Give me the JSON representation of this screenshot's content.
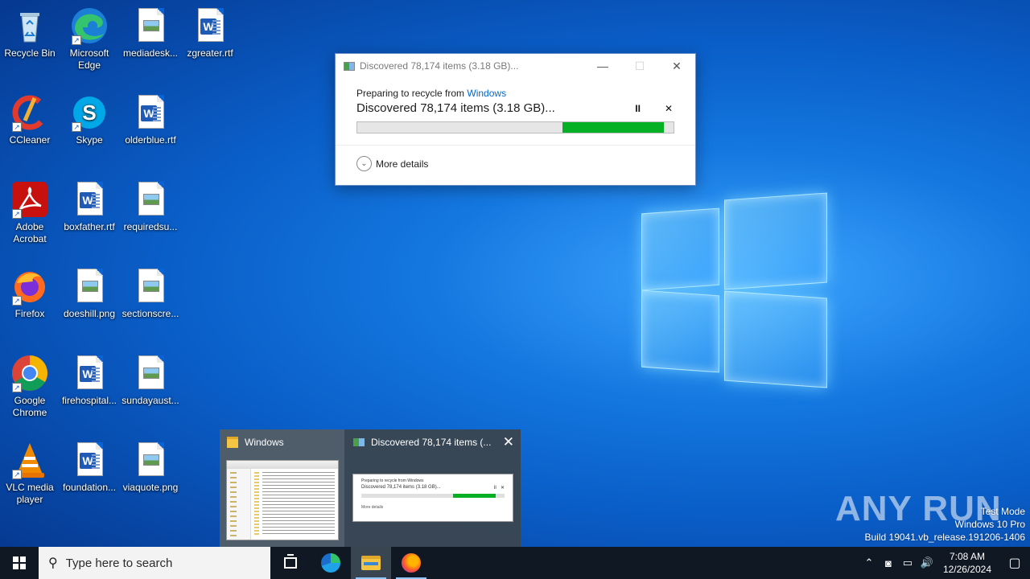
{
  "desktop": {
    "icons": [
      {
        "label": "Recycle Bin",
        "icon": "recycle-bin-icon"
      },
      {
        "label": "Microsoft Edge",
        "icon": "edge-icon"
      },
      {
        "label": "mediadesk...",
        "icon": "image-file-icon"
      },
      {
        "label": "zgreater.rtf",
        "icon": "word-document-icon"
      },
      {
        "label": "CCleaner",
        "icon": "ccleaner-icon"
      },
      {
        "label": "Skype",
        "icon": "skype-icon"
      },
      {
        "label": "olderblue.rtf",
        "icon": "word-document-icon"
      },
      {
        "label": "Adobe Acrobat",
        "icon": "acrobat-icon"
      },
      {
        "label": "boxfather.rtf",
        "icon": "word-document-icon"
      },
      {
        "label": "requiredsu...",
        "icon": "image-file-icon"
      },
      {
        "label": "Firefox",
        "icon": "firefox-icon"
      },
      {
        "label": "doeshill.png",
        "icon": "image-file-icon"
      },
      {
        "label": "sectionscre...",
        "icon": "image-file-icon"
      },
      {
        "label": "Google Chrome",
        "icon": "chrome-icon"
      },
      {
        "label": "firehospital...",
        "icon": "word-document-icon"
      },
      {
        "label": "sundayaust...",
        "icon": "image-file-icon"
      },
      {
        "label": "VLC media player",
        "icon": "vlc-icon"
      },
      {
        "label": "foundation...",
        "icon": "word-document-icon"
      },
      {
        "label": "viaquote.png",
        "icon": "image-file-icon"
      }
    ]
  },
  "dialog": {
    "title": "Discovered 78,174 items (3.18 GB)...",
    "prep_prefix": "Preparing to recycle from ",
    "prep_link": "Windows",
    "status": "Discovered 78,174 items (3.18 GB)...",
    "pause_glyph": "II",
    "cancel_glyph": "✕",
    "more_details": "More details",
    "progress_state": "indeterminate",
    "progress_color": "#06b025"
  },
  "thumbnails": {
    "explorer_title": "Windows",
    "dialog_title": "Discovered 78,174 items (...",
    "mini_prep": "Preparing to recycle from Windows",
    "mini_status": "Discovered 78,174 items (3.18 GB)...",
    "mini_more": "More details"
  },
  "watermark": {
    "brand": "ANY RUN",
    "line1": "Test Mode",
    "line2": "Windows 10 Pro",
    "line3": "Build 19041.vb_release.191206-1406"
  },
  "taskbar": {
    "search_placeholder": "Type here to search",
    "time": "7:08 AM",
    "date": "12/26/2024"
  }
}
